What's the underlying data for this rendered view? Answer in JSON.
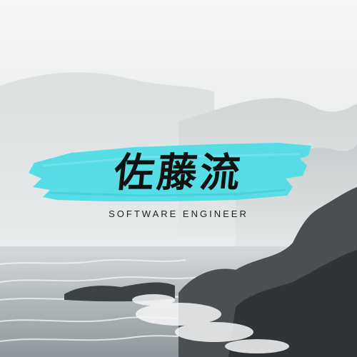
{
  "logo": {
    "name": "佐藤流",
    "tagline": "SOFTWARE ENGINEER",
    "brush_color": "#57dde6",
    "text_color": "#111111"
  },
  "background": {
    "description_icon": "misty-sea-coast-photo"
  }
}
